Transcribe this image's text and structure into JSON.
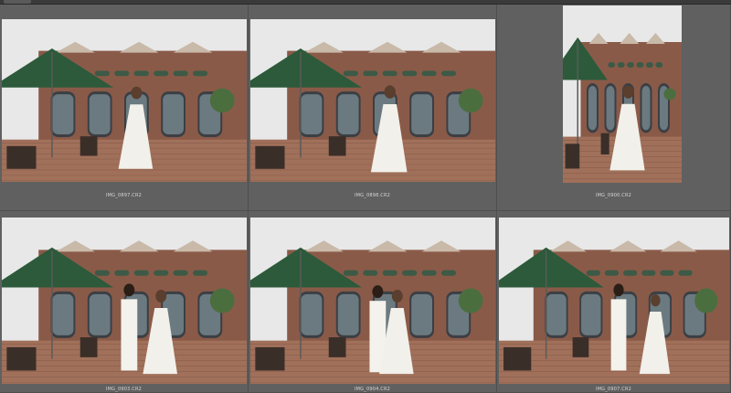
{
  "window": {
    "top_tab_icon": "tab-icon"
  },
  "grid": {
    "columns": 3,
    "rows": 2,
    "cells": [
      {
        "filename": "IMG_0897.CR2",
        "scene": "woman-alone-left",
        "orientation": "landscape",
        "selected": false
      },
      {
        "filename": "IMG_0898.CR2",
        "scene": "woman-alone-center",
        "orientation": "landscape",
        "selected": false
      },
      {
        "filename": "IMG_0900.CR2",
        "scene": "woman-alone-portrait",
        "orientation": "portrait",
        "selected": false
      },
      {
        "filename": "IMG_0903.CR2",
        "scene": "couple-left",
        "orientation": "landscape",
        "selected": false
      },
      {
        "filename": "IMG_0904.CR2",
        "scene": "couple-center",
        "orientation": "landscape",
        "selected": false
      },
      {
        "filename": "IMG_0907.CR2",
        "scene": "couple-holding",
        "orientation": "landscape",
        "selected": false
      }
    ]
  },
  "colors": {
    "background": "#5f5f5f",
    "cell_border": "#4e4e4e",
    "filename_text": "#d8d8d8",
    "umbrella": "#2c5a3a",
    "building_brick": "#8a5a48",
    "sky": "#e8e8e8",
    "deck": "#a0705a"
  }
}
